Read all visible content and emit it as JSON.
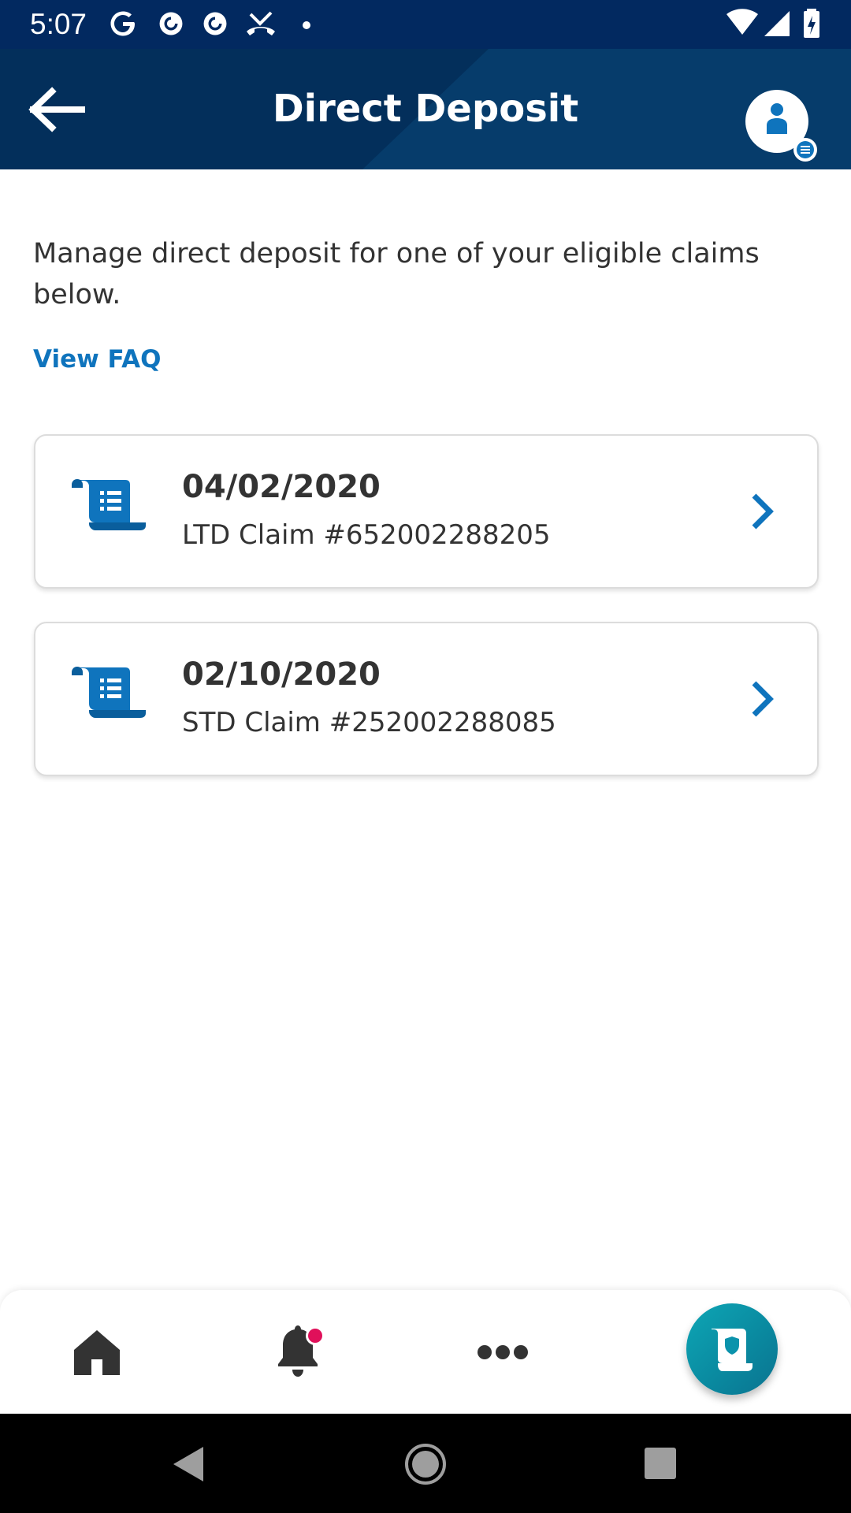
{
  "status_bar": {
    "time": "5:07",
    "icons": [
      "google-icon",
      "pocket-casts-icon",
      "pocket-casts-icon",
      "missed-call-icon",
      "more-dot-icon",
      "wifi-icon",
      "cell-signal-icon",
      "battery-icon"
    ]
  },
  "header": {
    "title": "Direct Deposit",
    "back_icon": "back-arrow-icon",
    "profile_icon": "profile-menu-icon",
    "background": "#063c6b"
  },
  "content": {
    "intro": "Manage direct deposit for one of your eligible claims below.",
    "faq_link": "View FAQ",
    "claims": [
      {
        "date": "04/02/2020",
        "description": "LTD Claim #652002288205",
        "icon": "claim-document-icon"
      },
      {
        "date": "02/10/2020",
        "description": "STD Claim #252002288085",
        "icon": "claim-document-icon"
      }
    ]
  },
  "bottom_nav": {
    "items": [
      "home-icon",
      "notifications-bell-icon",
      "more-icon",
      "claims-fab-icon"
    ],
    "notification_dot_color": "#e0105a",
    "fab_color": "#0b93ac"
  },
  "system_nav": [
    "back-triangle-icon",
    "home-circle-icon",
    "recents-square-icon"
  ],
  "colors": {
    "status_bar": "#022960",
    "accent": "#0f74bd",
    "text": "#333333",
    "card_border": "#dcdcdc"
  }
}
